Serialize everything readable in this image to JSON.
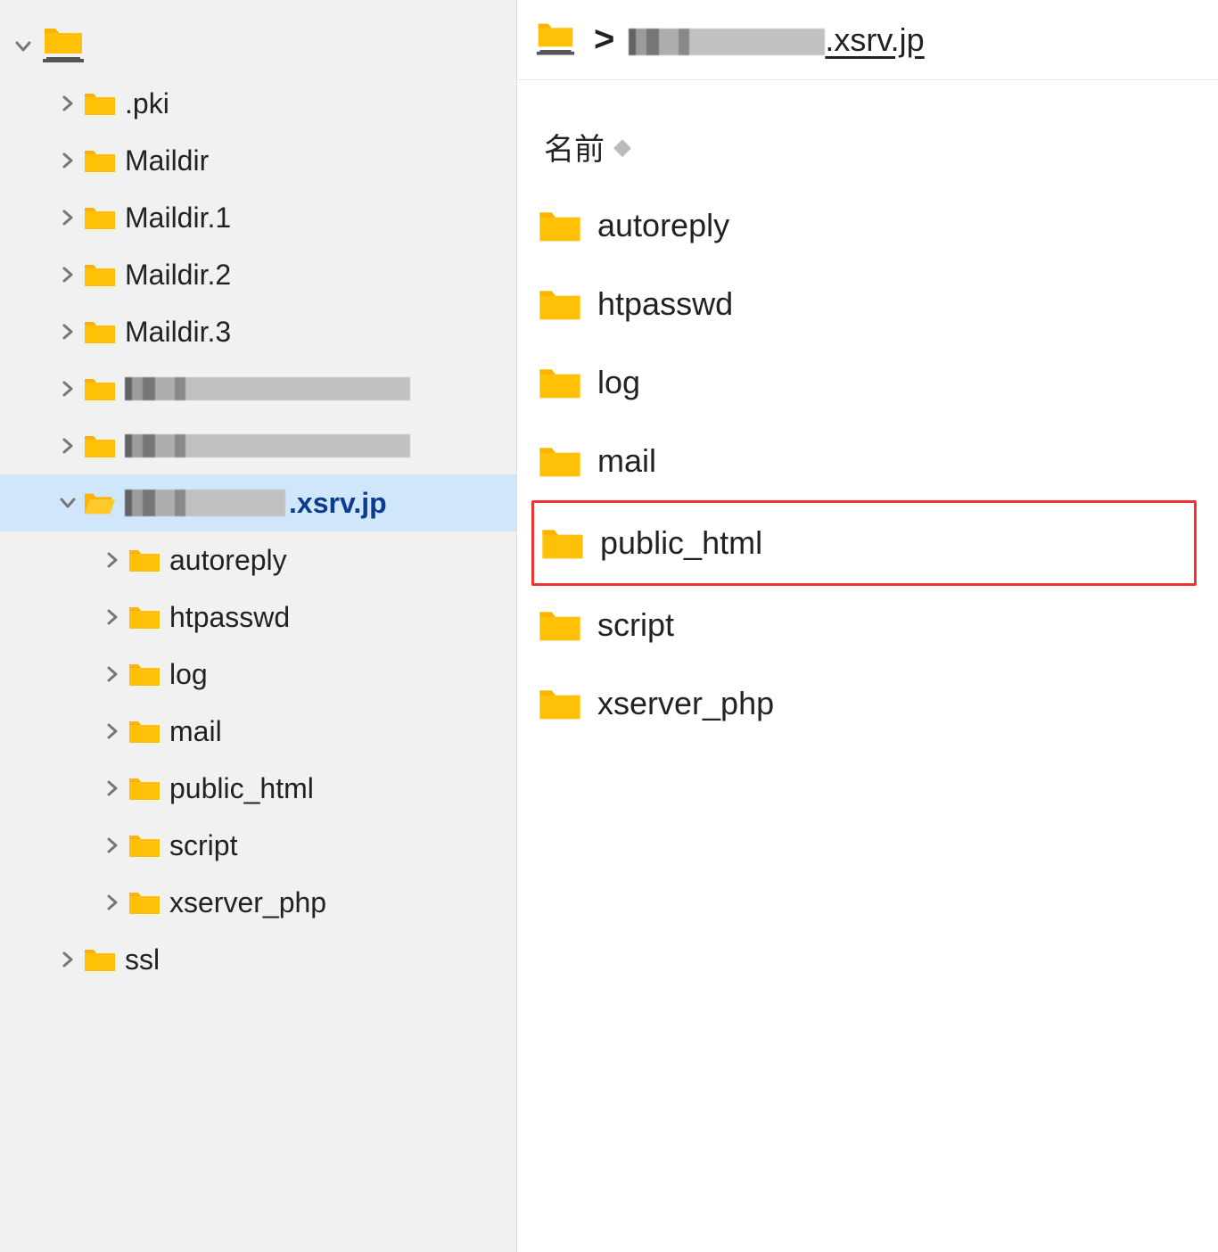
{
  "breadcrumb": {
    "domain_suffix": ".xsrv.jp"
  },
  "column_header": {
    "name": "名前"
  },
  "tree": {
    "root": {
      "expanded": true,
      "children": [
        {
          "label": ".pki",
          "pixelated": false
        },
        {
          "label": "Maildir",
          "pixelated": false
        },
        {
          "label": "Maildir.1",
          "pixelated": false
        },
        {
          "label": "Maildir.2",
          "pixelated": false
        },
        {
          "label": "Maildir.3",
          "pixelated": false
        },
        {
          "label": "",
          "pixelated": true
        },
        {
          "label": "",
          "pixelated": true
        },
        {
          "label_suffix": ".xsrv.jp",
          "pixelated_prefix": true,
          "expanded": true,
          "selected": true,
          "open_icon": true,
          "children": [
            {
              "label": "autoreply"
            },
            {
              "label": "htpasswd"
            },
            {
              "label": "log"
            },
            {
              "label": "mail"
            },
            {
              "label": "public_html"
            },
            {
              "label": "script"
            },
            {
              "label": "xserver_php"
            }
          ]
        },
        {
          "label": "ssl",
          "pixelated": false
        }
      ]
    }
  },
  "file_list": [
    {
      "label": "autoreply",
      "highlighted": false
    },
    {
      "label": "htpasswd",
      "highlighted": false
    },
    {
      "label": "log",
      "highlighted": false
    },
    {
      "label": "mail",
      "highlighted": false
    },
    {
      "label": "public_html",
      "highlighted": true
    },
    {
      "label": "script",
      "highlighted": false
    },
    {
      "label": "xserver_php",
      "highlighted": false
    }
  ]
}
